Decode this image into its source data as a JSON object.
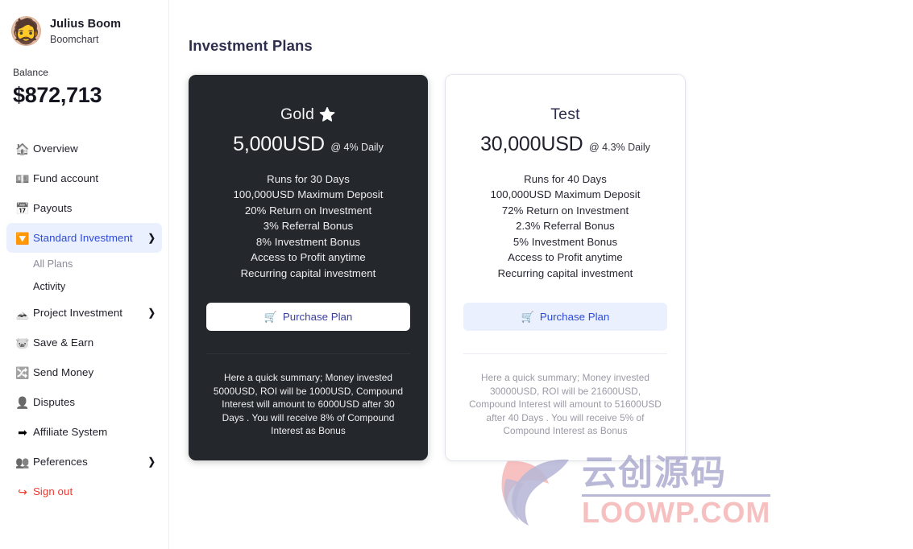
{
  "profile": {
    "avatar_icon": "person-face-avatar",
    "name": "Julius Boom",
    "subtitle": "Boomchart"
  },
  "balance": {
    "label": "Balance",
    "value": "$872,713"
  },
  "sidebar": {
    "items": [
      {
        "icon": "house-icon",
        "glyph": "🏠",
        "label": "Overview",
        "chevron": "",
        "active": false
      },
      {
        "icon": "banknote-icon",
        "glyph": "💵",
        "label": "Fund account",
        "chevron": "",
        "active": false
      },
      {
        "icon": "calendar-icon",
        "glyph": "📅",
        "label": "Payouts",
        "chevron": "",
        "active": false
      },
      {
        "icon": "chevron-double-down-icon",
        "glyph": "🔽",
        "label": "Standard Investment",
        "chevron": "❯",
        "active": true
      },
      {
        "icon": "mountain-icon",
        "glyph": "🗻",
        "label": "Project Investment",
        "chevron": "❯",
        "active": false
      },
      {
        "icon": "piggy-bank-icon",
        "glyph": "🐷",
        "label": "Save & Earn",
        "chevron": "",
        "active": false
      },
      {
        "icon": "shuffle-arrows-icon",
        "glyph": "🔀",
        "label": "Send Money",
        "chevron": "",
        "active": false
      },
      {
        "icon": "person-icon",
        "glyph": "👤",
        "label": "Disputes",
        "chevron": "",
        "active": false
      },
      {
        "icon": "arrow-right-curve-icon",
        "glyph": "➡",
        "label": "Affiliate System",
        "chevron": "",
        "active": false
      },
      {
        "icon": "people-gear-icon",
        "glyph": "👥",
        "label": "Peferences",
        "chevron": "❯",
        "active": false
      }
    ],
    "subitems": [
      {
        "label": "All Plans",
        "muted": true
      },
      {
        "label": "Activity",
        "muted": false
      }
    ],
    "signout": {
      "icon": "sign-out-icon",
      "glyph": "↪",
      "label": "Sign out"
    },
    "accent_color": "#2f4bd6",
    "active_bg": "#eaf0fd",
    "danger_color": "#f03a2f"
  },
  "main": {
    "page_title": "Investment Plans"
  },
  "plans": [
    {
      "theme": "dark",
      "name": "Gold",
      "badge_icon": "star-icon",
      "badge_glyph": "⭐",
      "amount": "5,000USD",
      "rate": "@ 4% Daily",
      "features": [
        "Runs for 30 Days",
        "100,000USD Maximum Deposit",
        "20% Return on Investment",
        "3% Referral Bonus",
        "8% Investment Bonus",
        "Access to Profit anytime",
        "Recurring capital investment"
      ],
      "button": {
        "icon": "shopping-cart-icon",
        "glyph": "🛒",
        "label": "Purchase Plan"
      },
      "summary": "Here a quick summary; Money invested 5000USD, ROI will be 1000USD, Compound Interest will amount to 6000USD after 30 Days . You will receive 8% of Compound Interest as Bonus"
    },
    {
      "theme": "light",
      "name": "Test",
      "badge_icon": "",
      "badge_glyph": "",
      "amount": "30,000USD",
      "rate": "@ 4.3% Daily",
      "features": [
        "Runs for 40 Days",
        "100,000USD Maximum Deposit",
        "72% Return on Investment",
        "2.3% Referral Bonus",
        "5% Investment Bonus",
        "Access to Profit anytime",
        "Recurring capital investment"
      ],
      "button": {
        "icon": "shopping-cart-icon",
        "glyph": "🛒",
        "label": "Purchase Plan"
      },
      "summary": "Here a quick summary; Money invested 30000USD, ROI will be 21600USD, Compound Interest will amount to 51600USD after 40 Days . You will receive 5% of Compound Interest as Bonus"
    }
  ],
  "watermark": {
    "logo_icon": "leaf-swirl-logo",
    "chinese_text": "云创源码",
    "domain_text": "LOOWP.COM",
    "purple": "#8f8fc0",
    "pink": "#f29b9b"
  }
}
